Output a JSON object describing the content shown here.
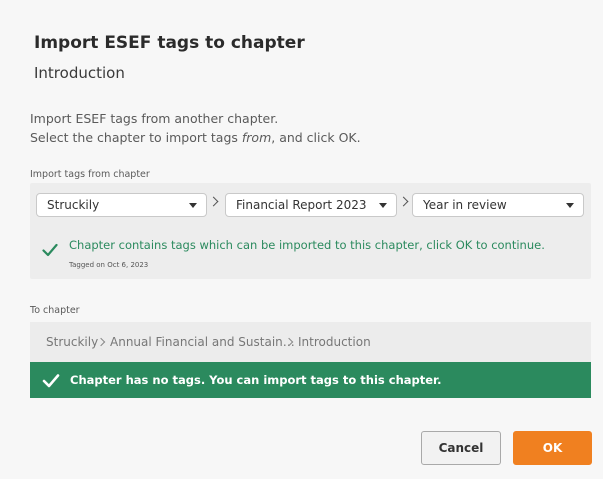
{
  "dialog": {
    "title": "Import ESEF tags to chapter",
    "subtitle": "Introduction",
    "description_line1": "Import ESEF tags from another chapter.",
    "description_line2_pre": "Select the chapter to import tags ",
    "description_line2_em": "from",
    "description_line2_post": ", and click OK."
  },
  "import_from": {
    "label": "Import tags from chapter",
    "selects": [
      {
        "value": "Struckily"
      },
      {
        "value": "Financial Report 2023"
      },
      {
        "value": "Year in review"
      }
    ],
    "status_icon": "check-icon",
    "status_message": "Chapter contains tags which can be imported to this chapter, click OK to continue.",
    "tagged_note": "Tagged on Oct 6, 2023"
  },
  "to_chapter": {
    "label": "To chapter",
    "path": [
      "Struckily",
      "Annual Financial and Sustain…",
      "Introduction"
    ],
    "banner_icon": "check-icon",
    "banner_message": "Chapter has no tags. You can import tags to this chapter."
  },
  "buttons": {
    "cancel": "Cancel",
    "ok": "OK"
  },
  "colors": {
    "success": "#2b8a5e",
    "primary": "#f08020"
  }
}
